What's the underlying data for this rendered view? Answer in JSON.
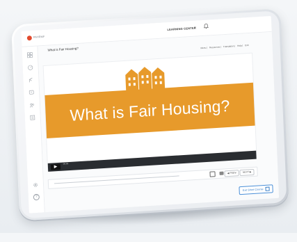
{
  "app": {
    "logo_text": "PAHRMF"
  },
  "topbar": {
    "menu_label": "LEARNING CENTER",
    "chevron": "⌄",
    "bell": "🔔"
  },
  "course": {
    "title": "What is Fair Housing?"
  },
  "links": [
    "Menu",
    "Resources",
    "Translation",
    "Help",
    "Exit"
  ],
  "video": {
    "banner_title": "What is Fair Housing?",
    "play_glyph": "▶",
    "time": "00:00"
  },
  "controls": {
    "prev_label": "◀ PREV",
    "next_label": "NEXT ▶"
  },
  "footer": {
    "exit_label": "Exit Short Course"
  },
  "colors": {
    "banner": "#e79a2b",
    "accent": "#e24a2e",
    "exit_blue": "#3a7fc8"
  },
  "sidebar_icons": [
    "grid-icon",
    "gauge-icon",
    "path-icon",
    "chat-icon",
    "people-icon",
    "list-icon"
  ]
}
